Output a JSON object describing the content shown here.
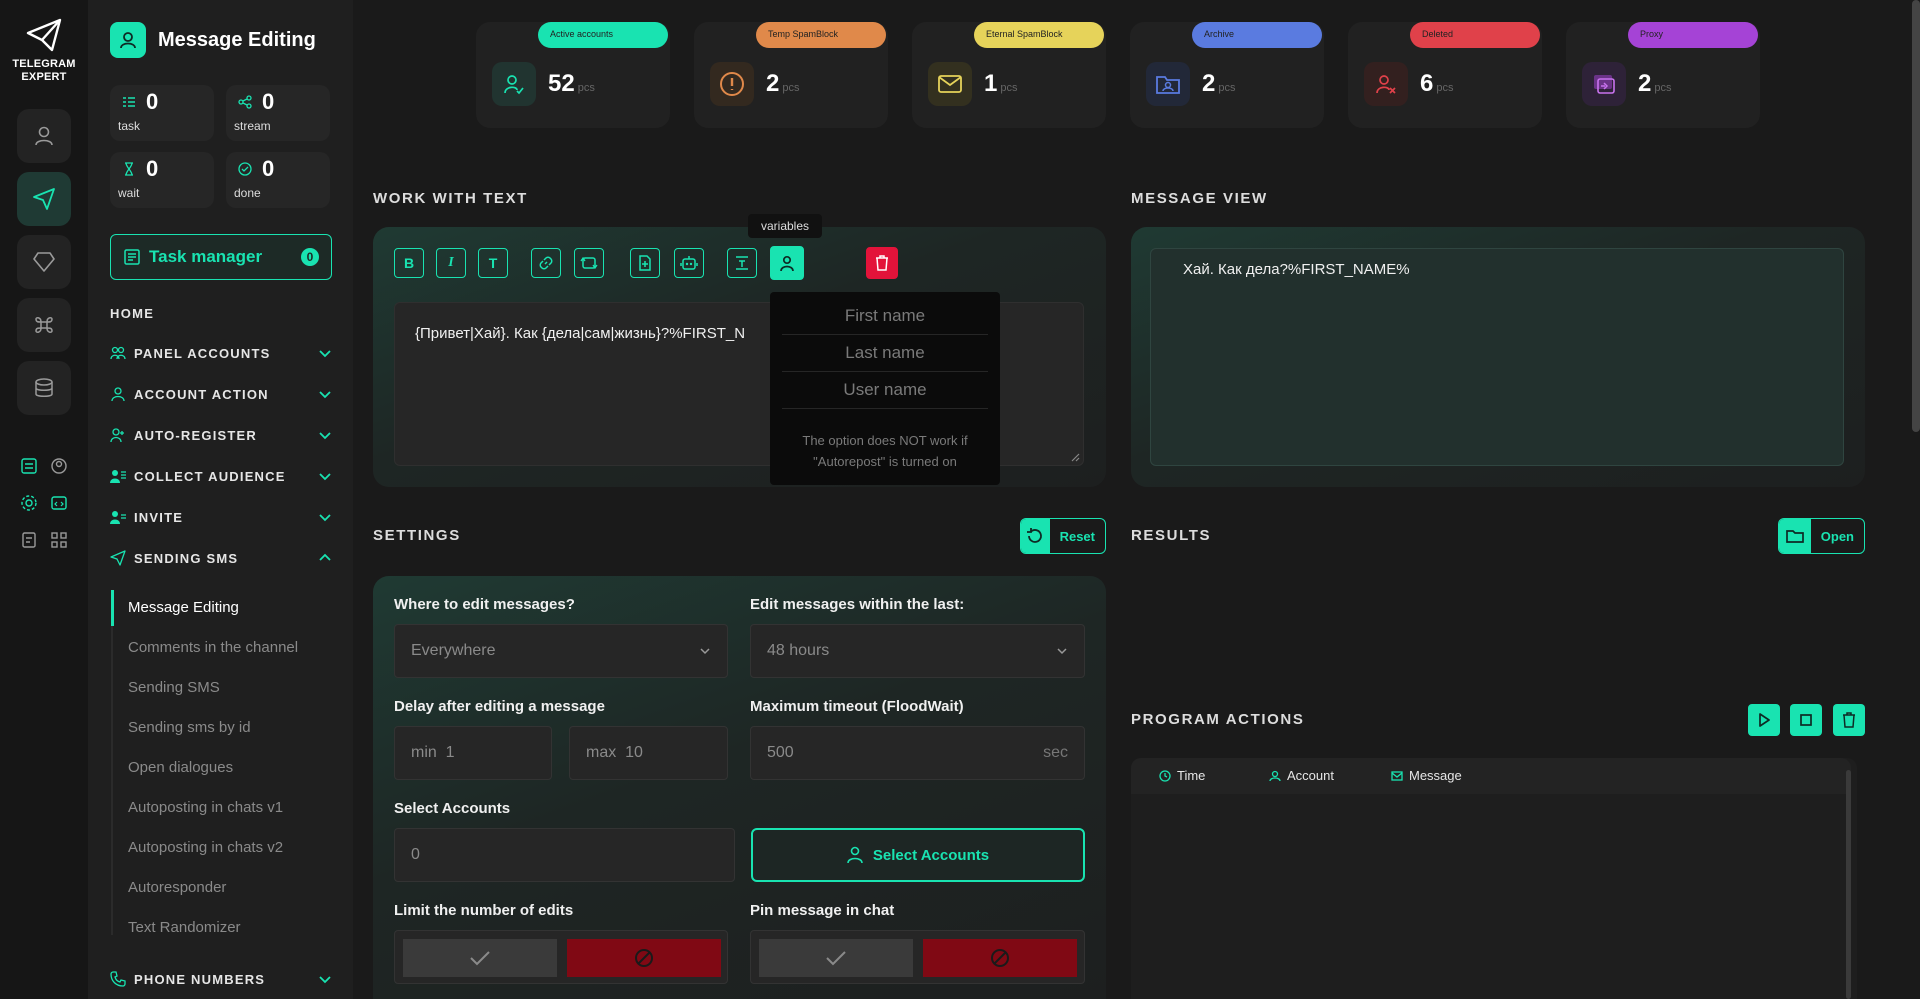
{
  "app": {
    "logo_text_line1": "TELEGRAM",
    "logo_text_line2": "EXPERT",
    "page_title": "Message Editing",
    "accent": "#19e3b1"
  },
  "stats": [
    {
      "icon": "task-icon",
      "value": "0",
      "label": "task"
    },
    {
      "icon": "stream-icon",
      "value": "0",
      "label": "stream"
    },
    {
      "icon": "hourglass-icon",
      "value": "0",
      "label": "wait"
    },
    {
      "icon": "check-circle-icon",
      "value": "0",
      "label": "done"
    }
  ],
  "task_manager": {
    "label": "Task manager",
    "count": "0"
  },
  "nav": {
    "home": "HOME",
    "sections": [
      {
        "label": "PANEL ACCOUNTS",
        "icon": "users-icon",
        "expanded": false
      },
      {
        "label": "ACCOUNT ACTION",
        "icon": "user-icon",
        "expanded": false
      },
      {
        "label": "AUTO-REGISTER",
        "icon": "user-plus-icon",
        "expanded": false
      },
      {
        "label": "COLLECT AUDIENCE",
        "icon": "user-list-icon",
        "expanded": false
      },
      {
        "label": "INVITE",
        "icon": "user-group-icon",
        "expanded": false
      },
      {
        "label": "SENDING SMS",
        "icon": "send-icon",
        "expanded": true
      },
      {
        "label": "PHONE NUMBERS",
        "icon": "phone-icon",
        "expanded": false
      }
    ],
    "sending_sms_items": [
      "Message Editing",
      "Comments in the channel",
      "Sending SMS",
      "Sending sms by id",
      "Open dialogues",
      "Autoposting in chats v1",
      "Autoposting in chats v2",
      "Autoresponder",
      "Text Randomizer"
    ],
    "active_item": "Message Editing"
  },
  "cards": [
    {
      "label": "Active accounts",
      "value": "52",
      "unit": "pcs",
      "color": "#19e3b1",
      "icon": "user-check-icon"
    },
    {
      "label": "Temp SpamBlock",
      "value": "2",
      "unit": "pcs",
      "color": "#e0894a",
      "icon": "warning-icon"
    },
    {
      "label": "Eternal SpamBlock",
      "value": "1",
      "unit": "pcs",
      "color": "#e6d35a",
      "icon": "mail-blocked-icon"
    },
    {
      "label": "Archive",
      "value": "2",
      "unit": "pcs",
      "color": "#5a7be0",
      "icon": "archive-folder-icon"
    },
    {
      "label": "Deleted",
      "value": "6",
      "unit": "pcs",
      "color": "#e0414a",
      "icon": "user-x-icon"
    },
    {
      "label": "Proxy",
      "value": "2",
      "unit": "pcs",
      "color": "#a543d6",
      "icon": "proxy-icon"
    }
  ],
  "work_with_text": {
    "title": "WORK WITH TEXT",
    "tooltip": "variables",
    "text": "{Привет|Хай}. Как {дела|сам|жизнь}?%FIRST_N",
    "variables": [
      "First name",
      "Last name",
      "User name"
    ],
    "variables_note": "The option does NOT work if \"Autorepost\" is turned on"
  },
  "message_view": {
    "title": "MESSAGE VIEW",
    "text": "Хай. Как дела?%FIRST_NAME%"
  },
  "settings": {
    "title": "SETTINGS",
    "reset_label": "Reset",
    "where_label": "Where to edit messages?",
    "where_value": "Everywhere",
    "within_label": "Edit messages within the last:",
    "within_value": "48 hours",
    "delay_label": "Delay after editing a message",
    "delay_min_prefix": "min",
    "delay_min": "1",
    "delay_max_prefix": "max",
    "delay_max": "10",
    "timeout_label": "Maximum timeout (FloodWait)",
    "timeout_value": "500",
    "timeout_unit": "sec",
    "select_accounts_label": "Select Accounts",
    "select_accounts_value": "0",
    "select_accounts_button": "Select Accounts",
    "limit_label": "Limit the number of edits",
    "pin_label": "Pin message in chat"
  },
  "results": {
    "title": "RESULTS",
    "open_label": "Open"
  },
  "program_actions": {
    "title": "PROGRAM ACTIONS",
    "columns": [
      "Time",
      "Account",
      "Message"
    ]
  }
}
